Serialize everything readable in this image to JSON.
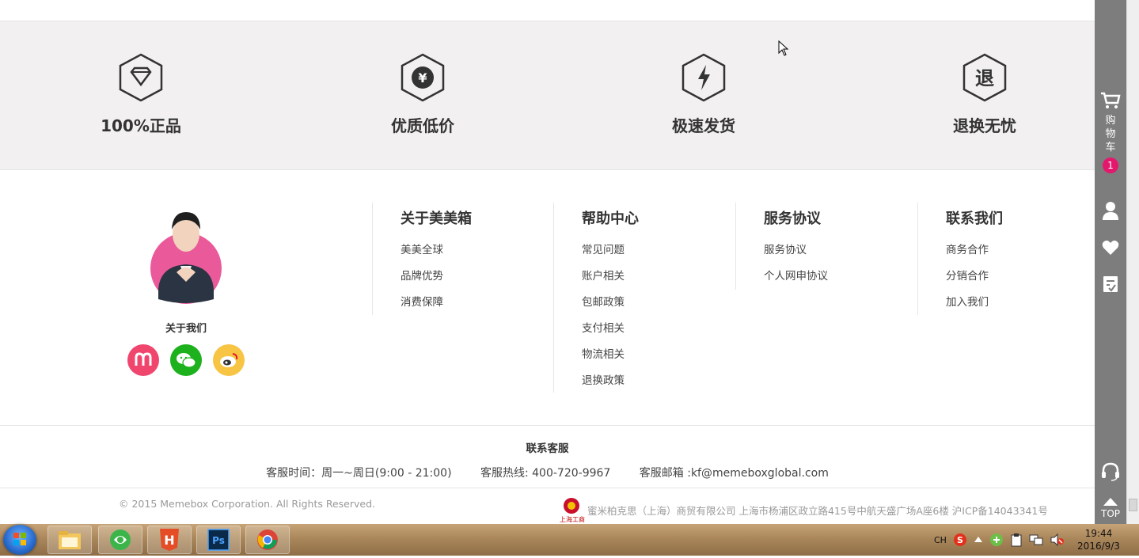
{
  "features": [
    {
      "label": "100%正品",
      "icon": "diamond-icon"
    },
    {
      "label": "优质低价",
      "icon": "yuan-icon"
    },
    {
      "label": "极速发货",
      "icon": "lightning-icon"
    },
    {
      "label": "退换无忧",
      "icon": "return-icon",
      "glyph": "退"
    }
  ],
  "about": {
    "title": "关于我们",
    "socials": [
      {
        "icon": "meme-logo-icon",
        "color": "#f0466e"
      },
      {
        "icon": "wechat-icon",
        "color": "#1db11d"
      },
      {
        "icon": "weibo-icon",
        "color": "#f7c443"
      }
    ]
  },
  "columns": [
    {
      "title": "关于美美箱",
      "links": [
        "美美全球",
        "品牌优势",
        "消费保障"
      ]
    },
    {
      "title": "帮助中心",
      "links": [
        "常见问题",
        "账户相关",
        "包邮政策",
        "支付相关",
        "物流相关",
        "退换政策"
      ]
    },
    {
      "title": "服务协议",
      "links": [
        "服务协议",
        "个人网申协议"
      ]
    },
    {
      "title": "联系我们",
      "links": [
        "商务合作",
        "分销合作",
        "加入我们"
      ]
    }
  ],
  "service": {
    "title": "联系客服",
    "hours": "客服时间：周一~周日(9:00 - 21:00)",
    "hotline": "客服热线: 400-720-9967",
    "email": "客服邮箱 :kf@memeboxglobal.com"
  },
  "bottom": {
    "copyright": "© 2015 Memebox Corporation. All Rights Reserved.",
    "company": "蜜米柏克思（上海）商贸有限公司 上海市杨浦区政立路415号中航天盛广场A座6楼 沪ICP备14043341号",
    "emblem_caption": "上海工商"
  },
  "sidebar": {
    "cart_label": "购物车",
    "cart_count": "1",
    "top_label": "TOP"
  },
  "taskbar": {
    "ime": "CH",
    "time": "19:44",
    "date": "2016/9/3"
  },
  "colors": {
    "accent": "#e3186d",
    "feature_bg": "#f2f0f1",
    "sidebar_bg": "#7d7d7d"
  }
}
